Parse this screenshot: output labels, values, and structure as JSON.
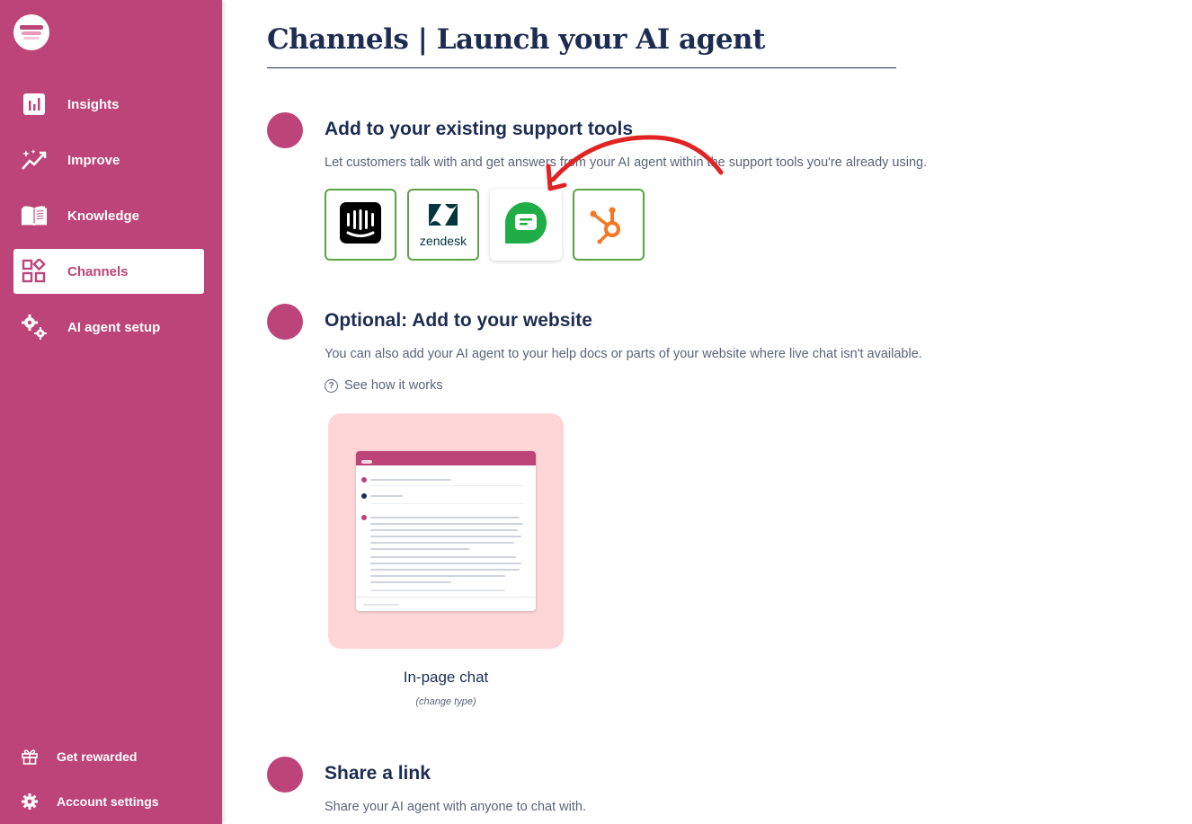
{
  "sidebar": {
    "items": [
      {
        "label": "Insights",
        "icon": "bar-chart-icon",
        "active": false
      },
      {
        "label": "Improve",
        "icon": "sparkle-trend-icon",
        "active": false
      },
      {
        "label": "Knowledge",
        "icon": "open-book-icon",
        "active": false
      },
      {
        "label": "Channels",
        "icon": "channels-grid-icon",
        "active": true
      },
      {
        "label": "AI agent setup",
        "icon": "gears-icon",
        "active": false
      }
    ],
    "footer": [
      {
        "label": "Get rewarded",
        "icon": "gift-icon"
      },
      {
        "label": "Account settings",
        "icon": "gear-icon"
      }
    ]
  },
  "page": {
    "title": "Channels | Launch your AI agent"
  },
  "sections": {
    "support_tools": {
      "heading": "Add to your existing support tools",
      "description": "Let customers talk with and get answers from your AI agent within the support tools you're already using.",
      "tools": [
        {
          "name": "intercom",
          "icon": "intercom-icon"
        },
        {
          "name": "zendesk",
          "label": "zendesk",
          "icon": "zendesk-icon"
        },
        {
          "name": "freshchat",
          "icon": "freshchat-icon"
        },
        {
          "name": "hubspot",
          "icon": "hubspot-icon"
        }
      ]
    },
    "website": {
      "heading": "Optional: Add to your website",
      "description": "You can also add your AI agent to your help docs or parts of your website where live chat isn't available.",
      "help_link": "See how it works",
      "preview_label": "In-page chat",
      "preview_sub": "(change type)"
    },
    "share": {
      "heading": "Share a link",
      "description": "Share your AI agent with anyone to chat with."
    }
  },
  "colors": {
    "brand": "#bd4479",
    "navy": "#1d2d52",
    "card_border": "#5aa443",
    "preview_bg": "#ffd6d8",
    "annotation_arrow": "#e02424"
  }
}
